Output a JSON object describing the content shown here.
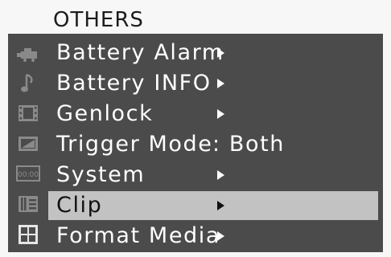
{
  "header": {
    "title": "OTHERS"
  },
  "sidebar": {
    "icons": [
      {
        "name": "camera-icon"
      },
      {
        "name": "audio-note-icon"
      },
      {
        "name": "film-icon"
      },
      {
        "name": "video-panel-icon"
      },
      {
        "name": "timecode-icon",
        "text": "00:00"
      },
      {
        "name": "media-icon"
      },
      {
        "name": "others-grid-icon"
      }
    ]
  },
  "menu": {
    "items": [
      {
        "label": "Battery Alarm",
        "arrow": true
      },
      {
        "label": "Battery INFO",
        "arrow": true
      },
      {
        "label": "Genlock",
        "arrow": true
      },
      {
        "label": "Trigger Mode",
        "value": ": Both"
      },
      {
        "label": "System",
        "arrow": true
      },
      {
        "label": "Clip",
        "arrow": true,
        "selected": true
      },
      {
        "label": "Format Media",
        "arrow": true
      }
    ]
  },
  "colors": {
    "panel": "#4b4b4b",
    "selected_row": "#c2c2c2",
    "text": "#ffffff",
    "header_text": "#1c1c1c"
  }
}
